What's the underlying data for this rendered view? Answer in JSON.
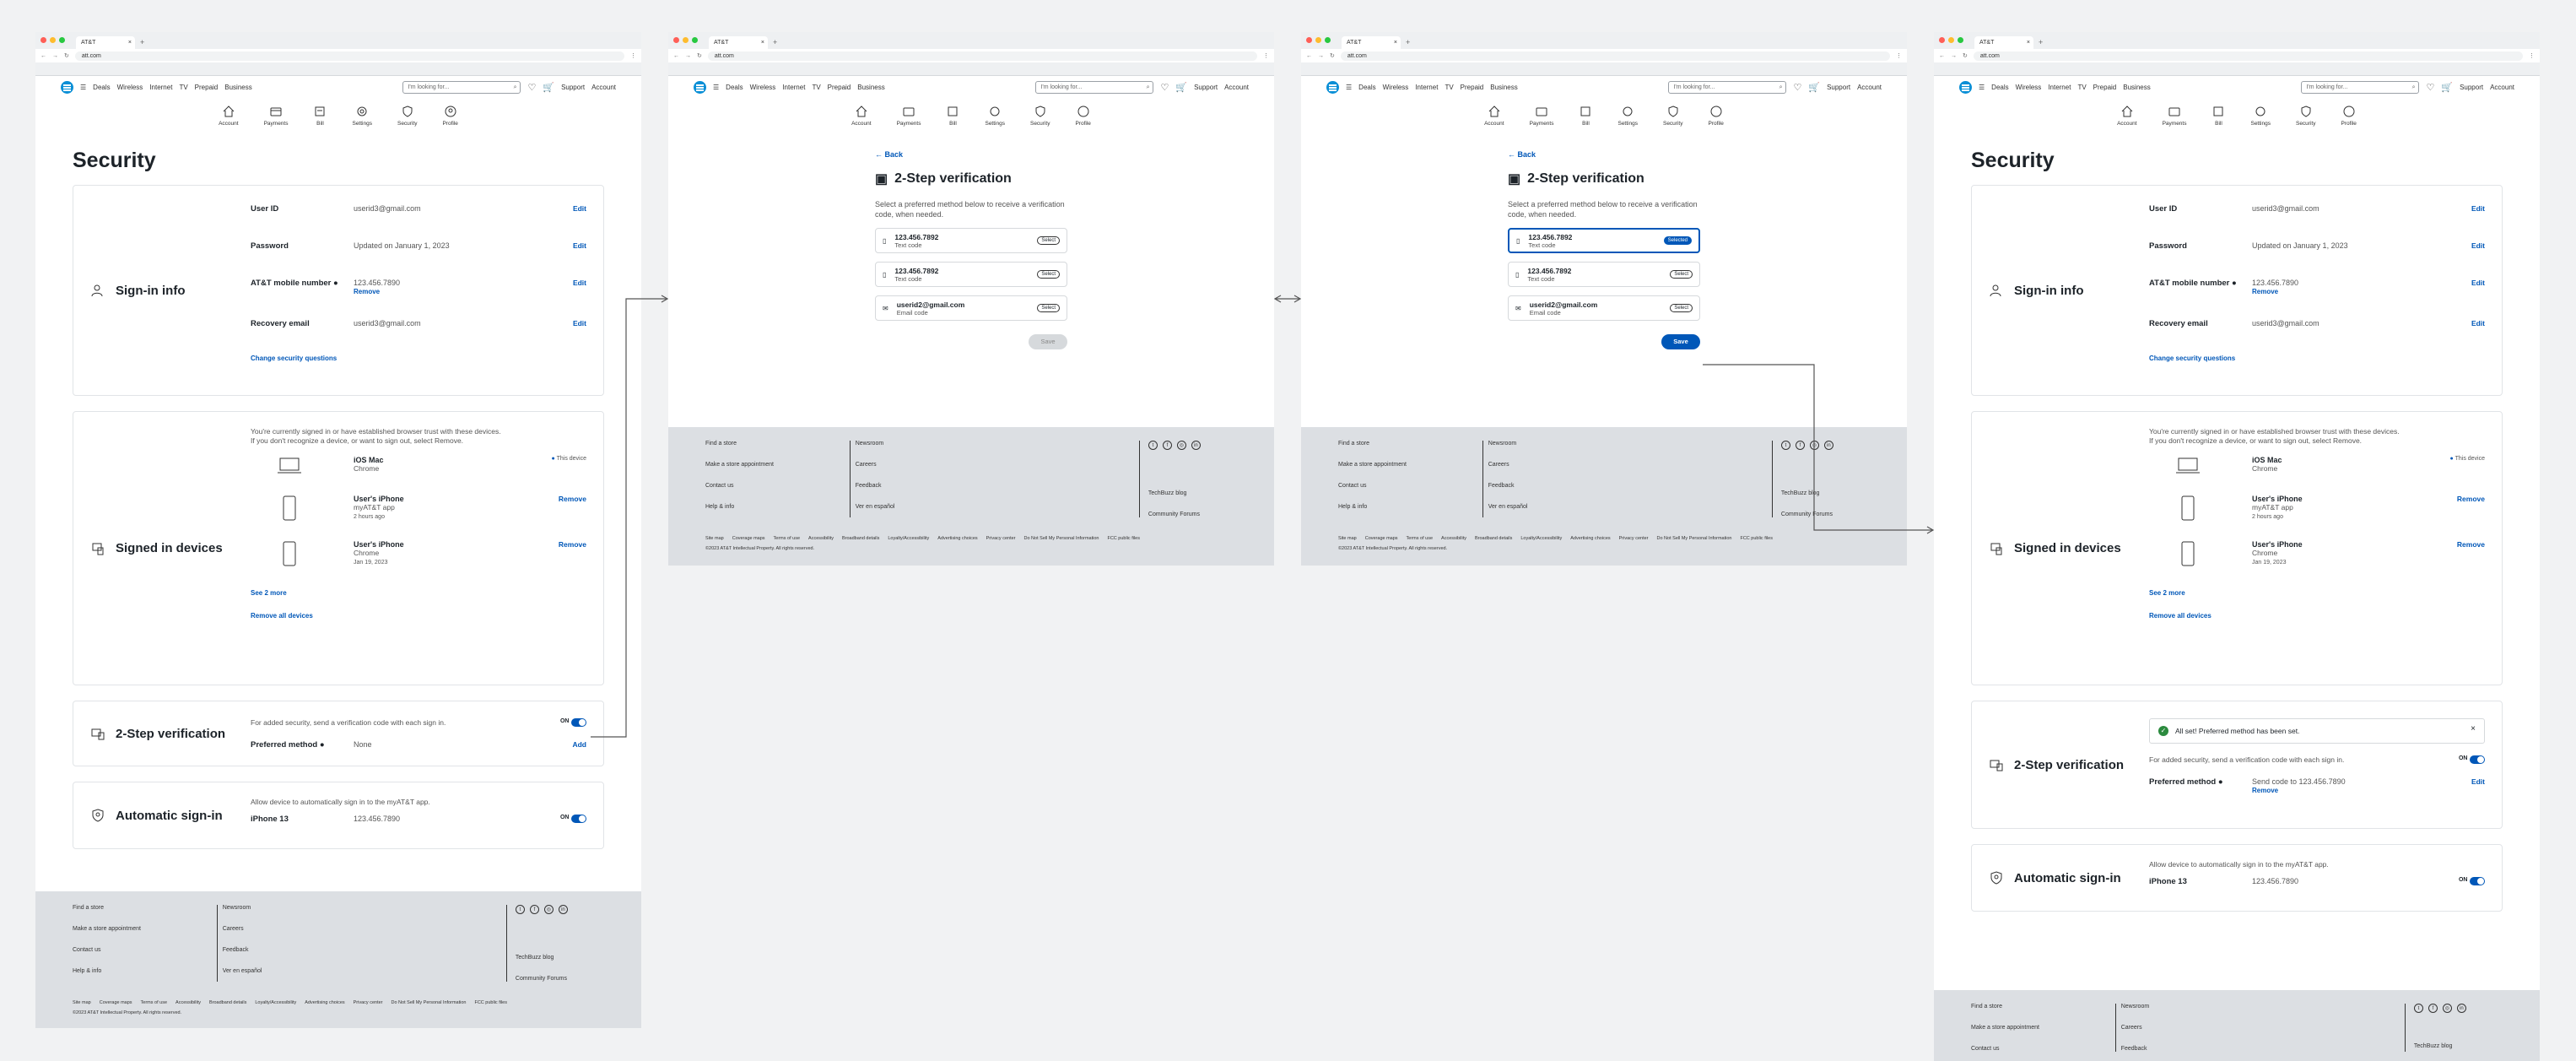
{
  "browser": {
    "tab_title": "AT&T",
    "url": "att.com",
    "new_tab": "+"
  },
  "header": {
    "nav": [
      "Deals",
      "Wireless",
      "Internet",
      "TV",
      "Prepaid",
      "Business"
    ],
    "search_placeholder": "I'm looking for...",
    "support": "Support",
    "account": "Account"
  },
  "account_nav": [
    "Account",
    "Payments",
    "Bill",
    "Settings",
    "Security",
    "Profile"
  ],
  "security": {
    "page_title": "Security",
    "signin": {
      "heading": "Sign-in info",
      "user_id_label": "User ID",
      "user_id": "userid3@gmail.com",
      "password_label": "Password",
      "password": "Updated on January 1, 2023",
      "mobile_label": "AT&T mobile number",
      "mobile": "123.456.7890",
      "remove": "Remove",
      "recovery_label": "Recovery email",
      "recovery": "userid3@gmail.com",
      "edit": "Edit",
      "change_questions": "Change security questions"
    },
    "devices": {
      "heading": "Signed in devices",
      "intro": "You're currently signed in or have established browser trust with these devices. If you don't recognize a device, or want to sign out, select Remove.",
      "list": [
        {
          "name": "iOS Mac",
          "app": "Chrome",
          "time": "",
          "status": "This device"
        },
        {
          "name": "User's iPhone",
          "app": "myAT&T app",
          "time": "2 hours ago",
          "status": "Remove"
        },
        {
          "name": "User's iPhone",
          "app": "Chrome",
          "time": "Jan 19, 2023",
          "status": "Remove"
        }
      ],
      "see_more": "See 2 more",
      "remove_all": "Remove all devices"
    },
    "two_step": {
      "heading": "2-Step verification",
      "desc": "For added security, send a verification code with each sign in.",
      "on": "ON",
      "preferred_label": "Preferred method",
      "preferred_none": "None",
      "add": "Add",
      "preferred_set": "Send code to 123.456.7890",
      "alert": "All set! Preferred method has been set.",
      "close": "×"
    },
    "auto": {
      "heading": "Automatic sign-in",
      "desc": "Allow device to automatically sign in to the myAT&T app.",
      "device_label": "iPhone 13",
      "device_value": "123.456.7890",
      "on": "ON"
    }
  },
  "verification": {
    "back": "← Back",
    "title": "2-Step verification",
    "desc": "Select a preferred method below to receive a verification code, when needed.",
    "options": [
      {
        "value": "123.456.7892",
        "type": "Text code"
      },
      {
        "value": "123.456.7892",
        "type": "Text code"
      },
      {
        "value": "userid2@gmail.com",
        "type": "Email code"
      }
    ],
    "select": "Select",
    "selected": "Selected",
    "save": "Save"
  },
  "footer": {
    "col1": [
      "Find a store",
      "Make a store appointment",
      "Contact us",
      "Help & info"
    ],
    "col2": [
      "Newsroom",
      "Careers",
      "Feedback",
      "Ver en español"
    ],
    "col3": [
      "TechBuzz blog",
      "Community Forums"
    ],
    "legal": [
      "Site map",
      "Coverage maps",
      "Terms of use",
      "Accessibility",
      "Broadband details",
      "Loyalty/Accessibility",
      "Advertising choices",
      "Privacy center",
      "Do Not Sell My Personal Information",
      "FCC public files"
    ],
    "copyright": "©2023 AT&T Intellectual Property. All rights reserved."
  }
}
